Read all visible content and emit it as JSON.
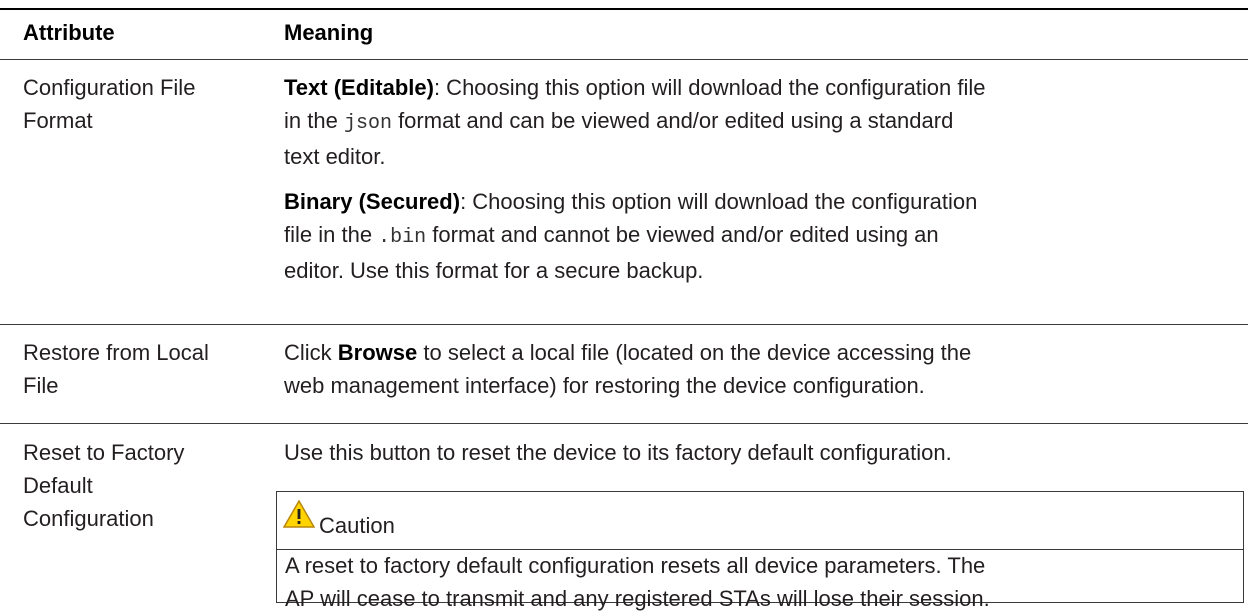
{
  "table": {
    "header": {
      "attribute": "Attribute",
      "meaning": "Meaning"
    },
    "rows": [
      {
        "attribute_l1": "Configuration File",
        "attribute_l2": "Format",
        "p1_term": "Text (Editable)",
        "p1_l1": ": Choosing this option will download the configuration file",
        "p1_l2_pre": "in the ",
        "p1_code": "json",
        "p1_l2_post": " format and can be viewed and/or edited using a standard",
        "p1_l3": "text editor.",
        "p2_term": "Binary (Secured)",
        "p2_l1": ": Choosing this option will download the configuration",
        "p2_l2_pre": "file in the ",
        "p2_code": ".bin",
        "p2_l2_post": " format and cannot be viewed and/or edited using an",
        "p2_l3": "editor. Use this format for a secure backup."
      },
      {
        "attribute_l1": "Restore from Local",
        "attribute_l2": "File",
        "l1_pre": "Click ",
        "l1_term": "Browse",
        "l1_post": " to select a local file (located on the device accessing the",
        "l2": "web management interface) for restoring the device configuration."
      },
      {
        "attribute_l1": "Reset to Factory",
        "attribute_l2": "Default",
        "attribute_l3": "Configuration",
        "l1": "Use this button to reset the device to its factory default configuration.",
        "caution_icon": "warning-triangle-icon",
        "caution_title": "Caution",
        "caution_l1": "A reset to factory default configuration resets all device parameters. The",
        "caution_l2": "AP will cease to transmit and any registered STAs will lose their session."
      }
    ]
  },
  "colors": {
    "caution_fill": "#ffd400",
    "caution_stroke": "#b8860b",
    "text": "#231f20"
  }
}
